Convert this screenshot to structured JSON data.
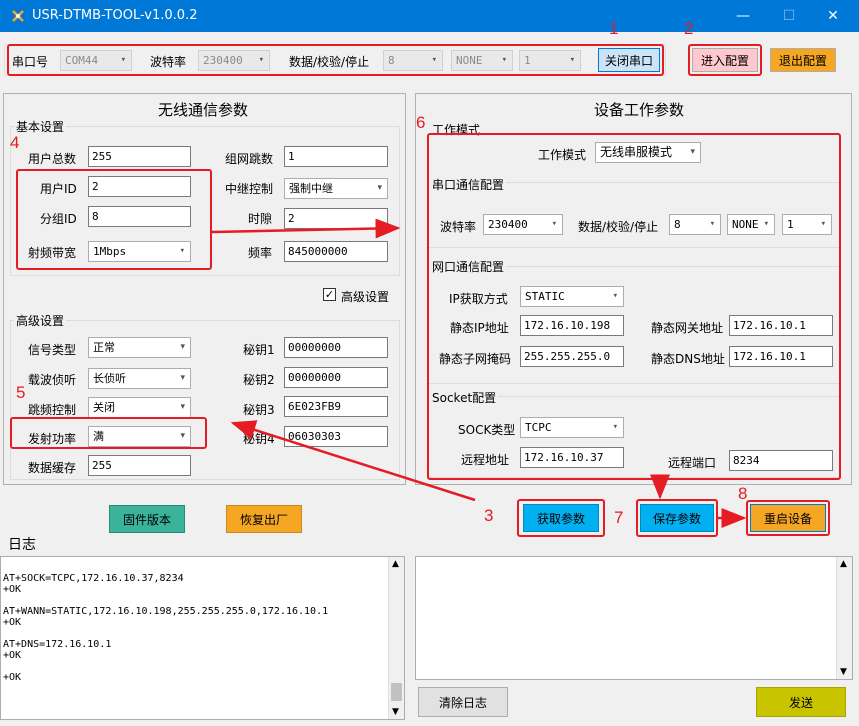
{
  "window": {
    "title": "USR-DTMB-TOOL-v1.0.0.2",
    "min": "—",
    "max": "☐",
    "close": "✕"
  },
  "serial": {
    "port_label": "串口号",
    "port": "COM44",
    "baud_label": "波特率",
    "baud": "230400",
    "dps_label": "数据/校验/停止",
    "data_bits": "8",
    "parity": "NONE",
    "stop_bits": "1",
    "close_btn": "关闭串口"
  },
  "config": {
    "enter": "进入配置",
    "exit": "退出配置"
  },
  "wireless": {
    "title": "无线通信参数",
    "basic_title": "基本设置",
    "user_total_label": "用户总数",
    "user_total": "255",
    "group_hop_label": "组网跳数",
    "group_hop": "1",
    "user_id_label": "用户ID",
    "user_id": "2",
    "relay_label": "中继控制",
    "relay": "强制中继",
    "group_id_label": "分组ID",
    "group_id": "8",
    "slot_label": "时隙",
    "slot": "2",
    "bw_label": "射频带宽",
    "bw": "1Mbps",
    "freq_label": "频率",
    "freq": "845000000",
    "advanced_check_label": "高级设置",
    "adv_title": "高级设置",
    "signal_label": "信号类型",
    "signal": "正常",
    "key1_label": "秘钥1",
    "key1": "00000000",
    "carrier_label": "载波侦听",
    "carrier": "长侦听",
    "key2_label": "秘钥2",
    "key2": "00000000",
    "hop_ctrl_label": "跳频控制",
    "hop_ctrl": "关闭",
    "key3_label": "秘钥3",
    "key3": "6E023FB9",
    "power_label": "发射功率",
    "power": "满",
    "key4_label": "秘钥4",
    "key4": "06030303",
    "cache_label": "数据缓存",
    "cache": "255"
  },
  "device": {
    "title": "设备工作参数",
    "mode_section": "工作模式",
    "mode_label": "工作模式",
    "mode": "无线串服模式",
    "uart_section": "串口通信配置",
    "baud_label": "波特率",
    "baud": "230400",
    "dps_label": "数据/校验/停止",
    "data_bits": "8",
    "parity": "NONE",
    "stop_bits": "1",
    "net_section": "网口通信配置",
    "ip_mode_label": "IP获取方式",
    "ip_mode": "STATIC",
    "ip_label": "静态IP地址",
    "ip": "172.16.10.198",
    "gw_label": "静态网关地址",
    "gw": "172.16.10.1",
    "mask_label": "静态子网掩码",
    "mask": "255.255.255.0",
    "dns_label": "静态DNS地址",
    "dns": "172.16.10.1",
    "socket_section": "Socket配置",
    "sock_type_label": "SOCK类型",
    "sock_type": "TCPC",
    "remote_addr_label": "远程地址",
    "remote_addr": "172.16.10.37",
    "remote_port_label": "远程端口",
    "remote_port": "8234"
  },
  "buttons": {
    "firmware": "固件版本",
    "factory": "恢复出厂",
    "get_params": "获取参数",
    "save_params": "保存参数",
    "reboot": "重启设备",
    "clear_log": "清除日志",
    "send": "发送"
  },
  "log": {
    "title": "日志",
    "text": "AT+SOCK=TCPC,172.16.10.37,8234\r\n+OK\n\nAT+WANN=STATIC,172.16.10.198,255.255.255.0,172.16.10.1\r\n+OK\n\nAT+DNS=172.16.10.1\r\n+OK\n\n+OK"
  },
  "annotations": [
    "1",
    "2",
    "3",
    "4",
    "5",
    "6",
    "7",
    "8"
  ],
  "colors": {
    "title_bar": "#0078d7",
    "teal": "#3bb29a",
    "orange": "#f5a623",
    "cyan": "#00b0f0",
    "red": "#e51c23",
    "olive": "#c8c400"
  }
}
